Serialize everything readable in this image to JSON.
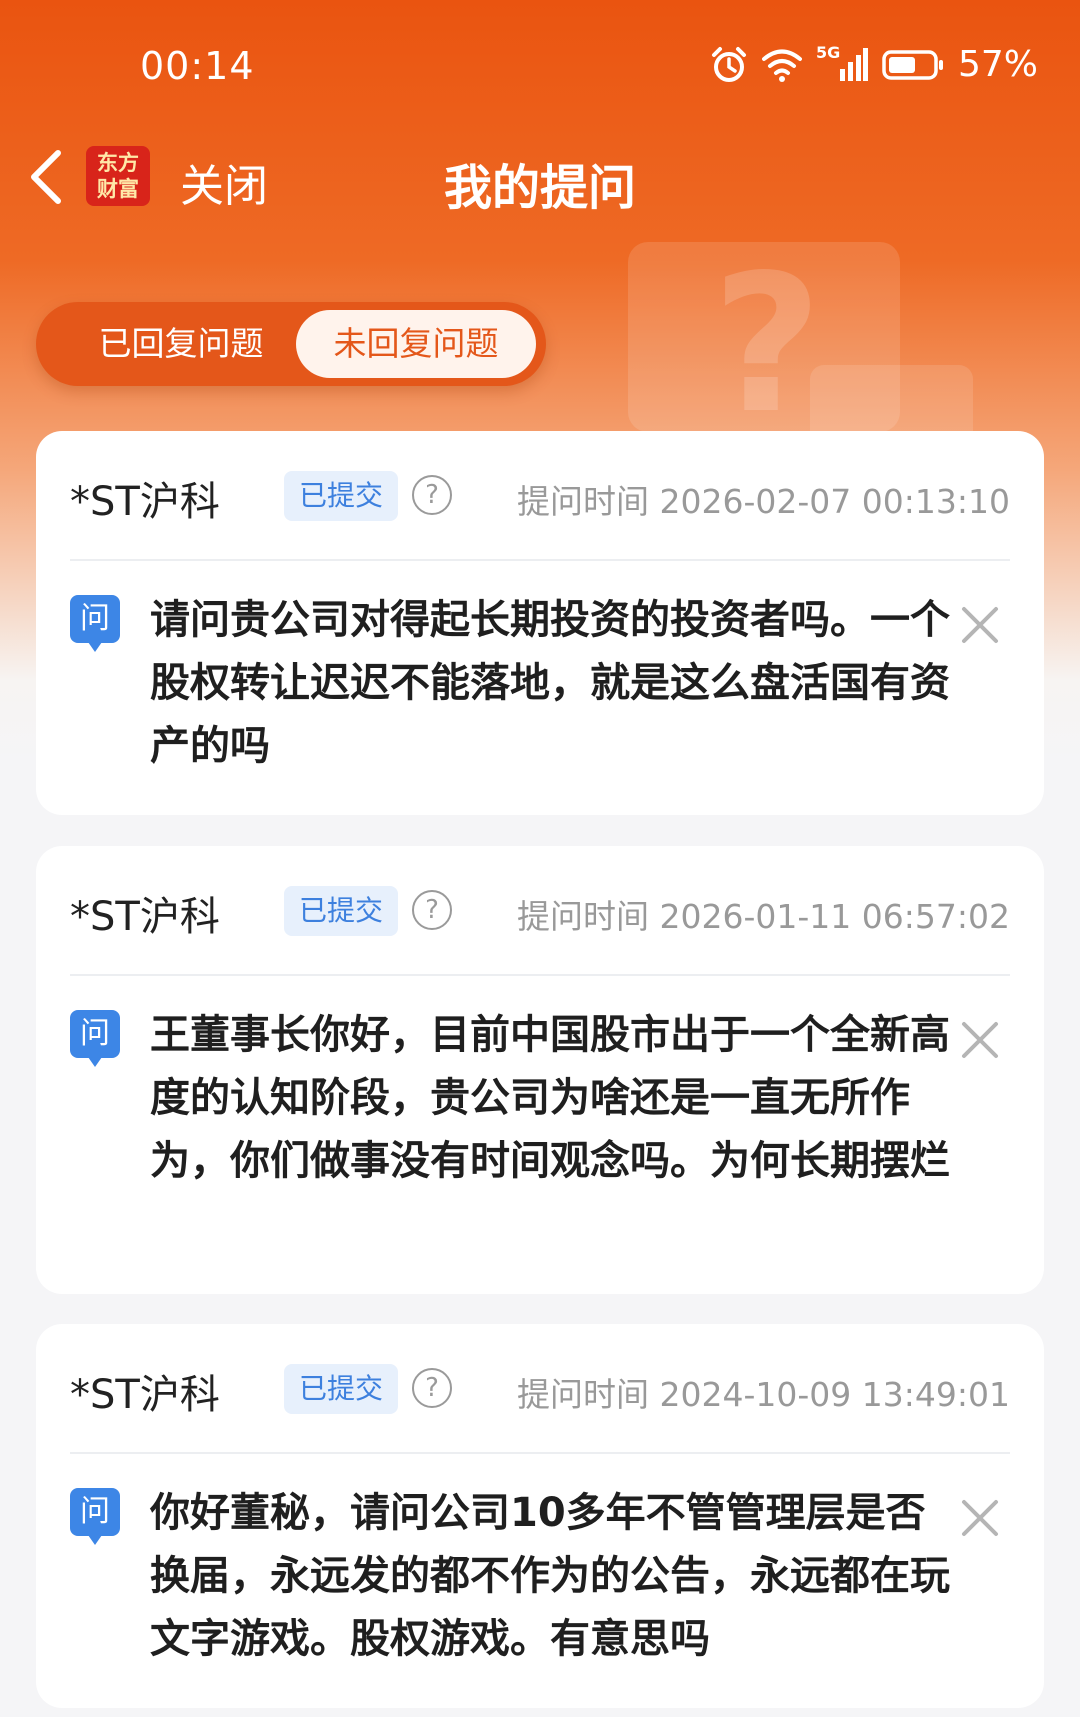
{
  "status_bar": {
    "time": "00:14",
    "signal": "5G",
    "battery": "57%"
  },
  "nav": {
    "back_icon": "chevron-left-icon",
    "logo_text_1": "东方",
    "logo_text_2": "财富",
    "close_label": "关闭",
    "title": "我的提问"
  },
  "tabs": [
    {
      "label": "已回复问题",
      "active": false
    },
    {
      "label": "未回复问题",
      "active": true
    }
  ],
  "questions": [
    {
      "stock": "*ST沪科",
      "status": "已提交",
      "time": "提问时间 2026-02-07 00:13:10",
      "q_label": "问",
      "text": "请问贵公司对得起长期投资的投资者吗。一个股权转让迟迟不能落地，就是这么盘活国有资产的吗"
    },
    {
      "stock": "*ST沪科",
      "status": "已提交",
      "time": "提问时间 2026-01-11 06:57:02",
      "q_label": "问",
      "text": "王董事长你好，目前中国股市出于一个全新高度的认知阶段，贵公司为啥还是一直无所作为，你们做事没有时间观念吗。为何长期摆烂"
    },
    {
      "stock": "*ST沪科",
      "status": "已提交",
      "time": "提问时间 2024-10-09 13:49:01",
      "q_label": "问",
      "text": "你好董秘，请问公司10多年不管管理层是否换届，永远发的都不作为的公告，永远都在玩文字游戏。股权游戏。有意思吗"
    }
  ],
  "colors": {
    "brand_orange": "#ea5410",
    "badge_blue": "#3d80de"
  }
}
